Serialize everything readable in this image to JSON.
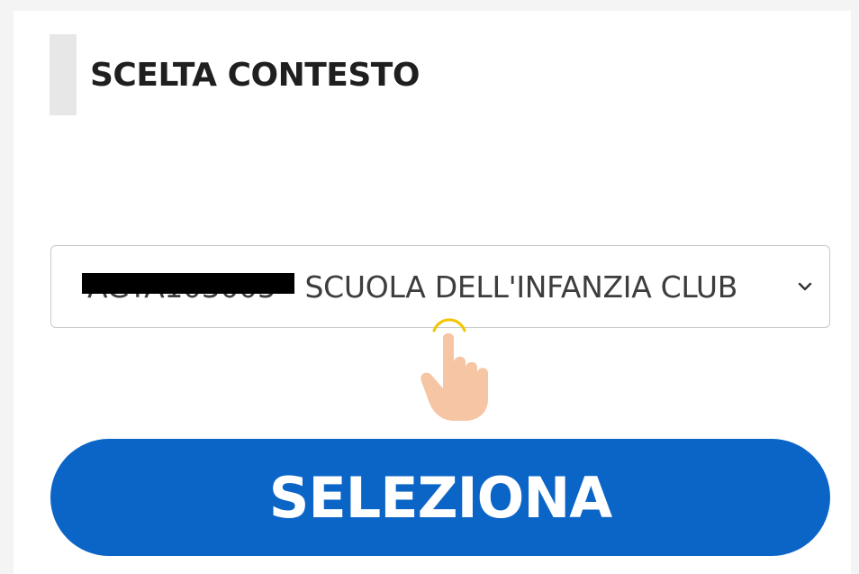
{
  "header": {
    "title": "SCELTA CONTESTO"
  },
  "context_select": {
    "selected_value": "AGTA103005 - SCUOLA DELL'INFANZIA CLUB",
    "arrow_icon": "chevron-down-icon"
  },
  "actions": {
    "select_button_label": "SELEZIONA"
  },
  "colors": {
    "accent": "#0b65c7",
    "title_bar": "#e7e7e7",
    "text": "#1f1f1f"
  }
}
